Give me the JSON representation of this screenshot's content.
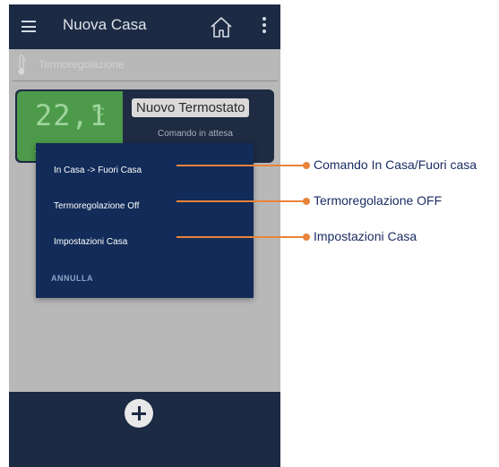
{
  "app": {
    "title": "Nuova Casa",
    "section": "Termoregolazione",
    "icons": [
      "hamburger-menu-icon",
      "home-icon",
      "more-vert-icon",
      "thermometer-icon",
      "plus-icon"
    ]
  },
  "card": {
    "temperature": "22,1",
    "unit": "°C",
    "dash": "—",
    "name": "Nuovo Termostato",
    "status": "Comando in attesa"
  },
  "dialog": {
    "items": [
      "In Casa -> Fuori Casa",
      "Termoregolazione Off",
      "Impostazioni Casa"
    ],
    "cancel": "ANNULLA"
  },
  "callouts": [
    "Comando In Casa/Fuori casa",
    "Termoregolazione OFF",
    "Impostazioni Casa"
  ],
  "colors": {
    "appbar": "#1c2a44",
    "dialog": "#122b58",
    "temp_box": "#4c9a4a",
    "callout_accent": "#e8843a",
    "callout_text": "#1a2d63"
  }
}
